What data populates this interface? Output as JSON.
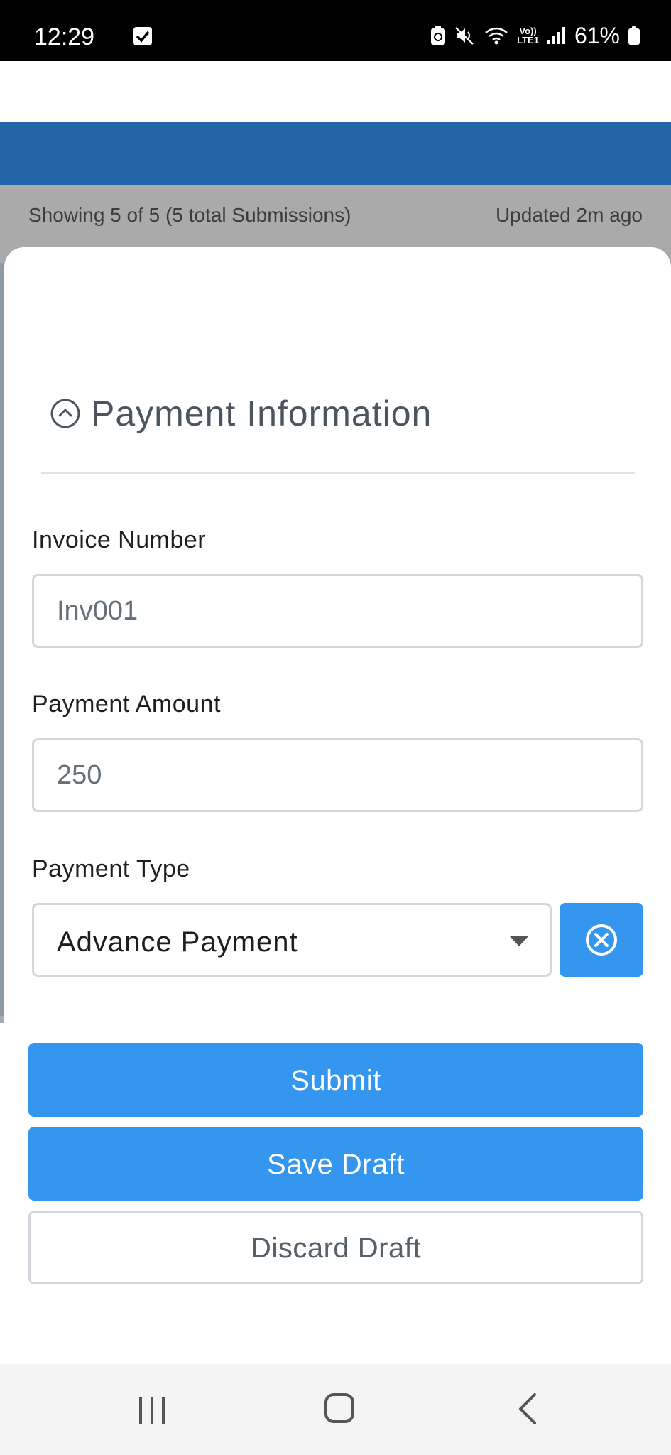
{
  "status_bar": {
    "time": "12:29",
    "network_top": "Vo))",
    "network_bottom": "LTE1",
    "battery_text": "61%"
  },
  "list_header": {
    "showing_text": "Showing 5 of 5 (5 total Submissions)",
    "updated_text": "Updated 2m ago"
  },
  "form": {
    "section_title": "Payment Information",
    "invoice_number": {
      "label": "Invoice Number",
      "value": "Inv001"
    },
    "payment_amount": {
      "label": "Payment Amount",
      "value": "250"
    },
    "payment_type": {
      "label": "Payment Type",
      "selected": "Advance Payment"
    }
  },
  "actions": {
    "submit_label": "Submit",
    "save_draft_label": "Save Draft",
    "discard_draft_label": "Discard Draft"
  },
  "colors": {
    "primary": "#3596ef",
    "header_bar": "#2266a8"
  },
  "icons": {
    "collapse": "chevron-up-circle-icon",
    "clear": "close-circle-icon"
  }
}
